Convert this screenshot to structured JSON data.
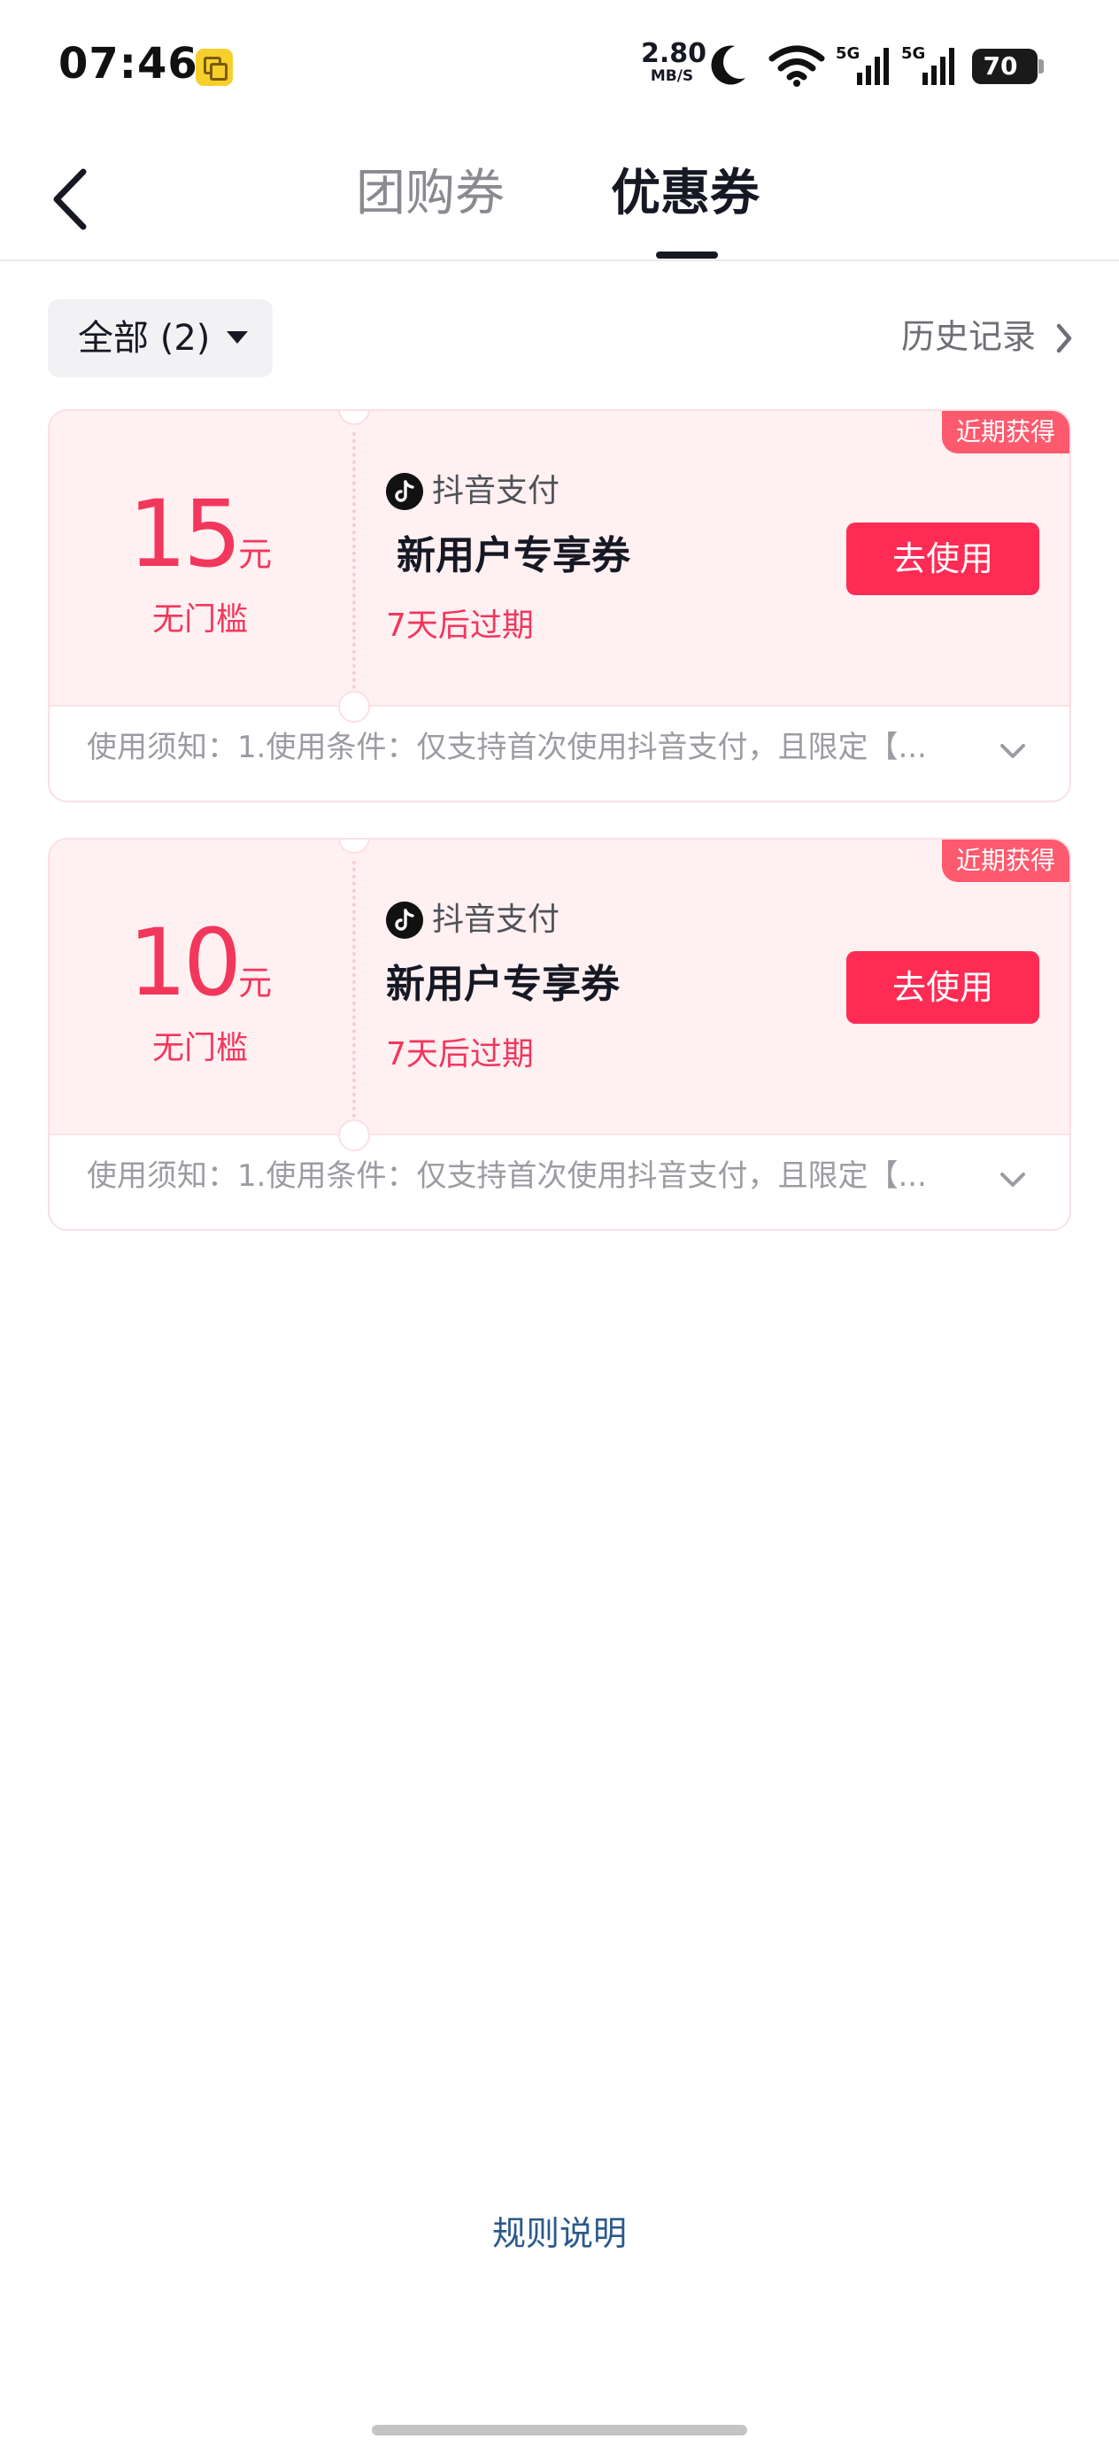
{
  "status_bar": {
    "time": "07:46",
    "app_icon": "copy-app-icon",
    "net_speed_value": "2.80",
    "net_speed_unit": "MB/S",
    "icons": [
      "moon-icon",
      "wifi-icon",
      "signal-5g-icon",
      "signal-5g-icon"
    ],
    "network_label_1": "5G",
    "network_label_2": "5G",
    "battery": "70"
  },
  "header": {
    "back_icon": "back-arrow-icon",
    "tabs": [
      {
        "label": "团购券",
        "active": false
      },
      {
        "label": "优惠券",
        "active": true
      }
    ]
  },
  "filter": {
    "label": "全部 (2)",
    "history_label": "历史记录"
  },
  "coupons": [
    {
      "amount": "15",
      "unit": "元",
      "threshold": "无门槛",
      "provider": "抖音支付",
      "provider_icon": "douyin-logo-icon",
      "title": "新用户专享券",
      "expiry": "7天后过期",
      "button": "去使用",
      "badge": "近期获得",
      "notice": "使用须知：1.使用条件：仅支持首次使用抖音支付，且限定【..."
    },
    {
      "amount": "10",
      "unit": "元",
      "threshold": "无门槛",
      "provider": "抖音支付",
      "provider_icon": "douyin-logo-icon",
      "title": "新用户专享券",
      "expiry": "7天后过期",
      "button": "去使用",
      "badge": "近期获得",
      "notice": "使用须知：1.使用条件：仅支持首次使用抖音支付，且限定【..."
    }
  ],
  "footer": {
    "rules_label": "规则说明"
  },
  "colors": {
    "accent": "#fe2c55",
    "price": "#f2375d",
    "card_background": "#fff0f2",
    "badge": "#fe5a6e",
    "link": "#2a5a8c"
  }
}
